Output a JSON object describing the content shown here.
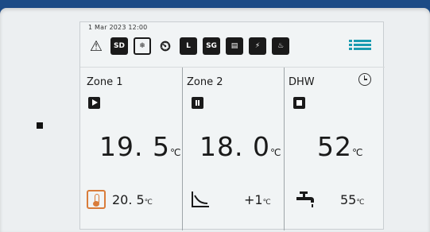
{
  "header": {
    "datetime": "1 Mar 2023 12:00",
    "status_icons": [
      {
        "name": "warning-icon",
        "label": "⚠"
      },
      {
        "name": "silent-mode-icon",
        "label": "SD"
      },
      {
        "name": "defrost-icon",
        "label": "❄"
      },
      {
        "name": "timer-icon",
        "label": "⏲"
      },
      {
        "name": "low-tariff-icon",
        "label": "L"
      },
      {
        "name": "smart-grid-icon",
        "label": "SG"
      },
      {
        "name": "boiler-icon",
        "label": "▤"
      },
      {
        "name": "electric-heater-icon",
        "label": "⚡"
      },
      {
        "name": "fire-icon",
        "label": "♨"
      }
    ]
  },
  "zones": [
    {
      "name": "Zone 1",
      "state": "running",
      "temperature": "19. 5",
      "unit": "℃",
      "setpoint": "20. 5",
      "setpoint_unit": "℃"
    },
    {
      "name": "Zone 2",
      "state": "paused",
      "temperature": "18. 0",
      "unit": "℃",
      "setpoint": "+1",
      "setpoint_unit": "℃"
    },
    {
      "name": "DHW",
      "state": "stopped",
      "temperature": "52",
      "unit": "℃",
      "setpoint": "55",
      "setpoint_unit": "℃"
    }
  ],
  "colors": {
    "accent": "#1a9bb0",
    "heating": "#d97c3a",
    "text": "#1a1a1a",
    "frame": "#16407a"
  }
}
